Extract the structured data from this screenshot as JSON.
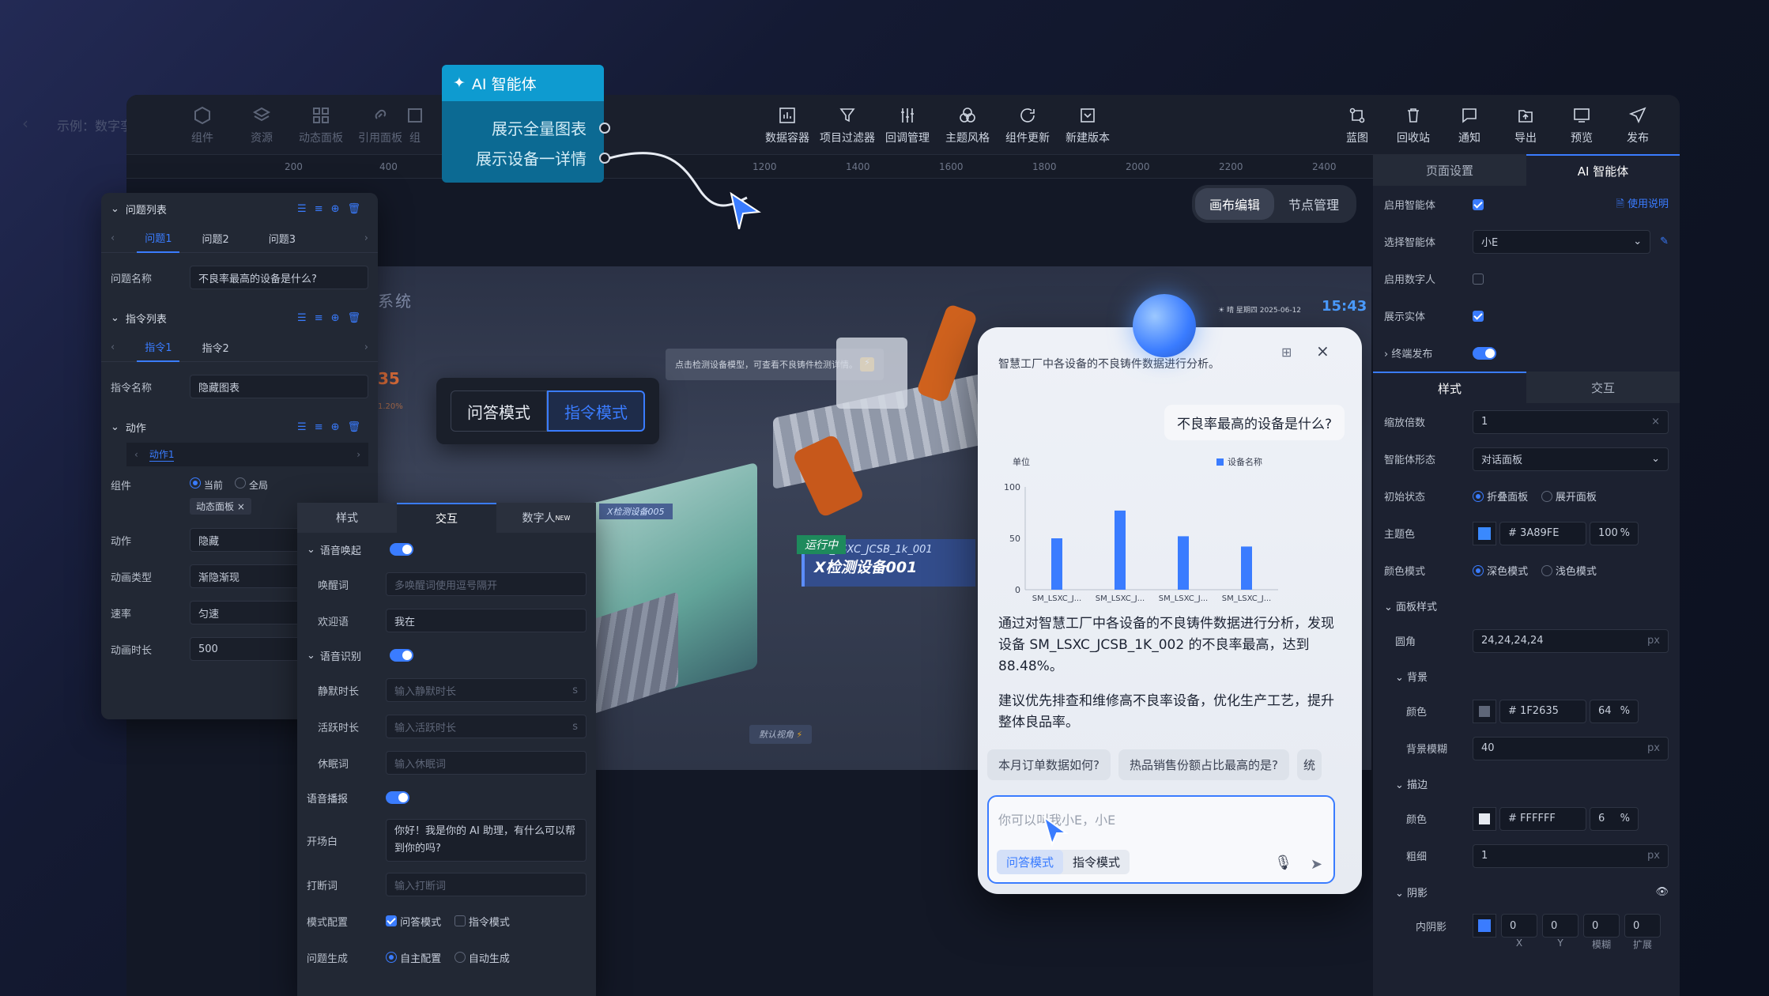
{
  "app": {
    "title": "示例：数字孪生...",
    "topleft_tools": [
      "组件",
      "资源",
      "动态面板",
      "引用面板",
      "组"
    ]
  },
  "toolbar": {
    "center": [
      "数据容器",
      "项目过滤器",
      "回调管理",
      "主题风格",
      "组件更新",
      "新建版本"
    ],
    "right": [
      "蓝图",
      "回收站",
      "通知",
      "导出",
      "预览",
      "发布"
    ]
  },
  "ai_popup": {
    "title": "AI 智能体",
    "items": [
      "展示全量图表",
      "展示设备一详情"
    ]
  },
  "ruler": {
    "ticks": [
      "200",
      "400",
      "1200",
      "1400",
      "1600",
      "1800",
      "2000",
      "2200",
      "2400"
    ]
  },
  "canvas_tabs": {
    "edit": "画布编辑",
    "node": "节点管理"
  },
  "left_panel": {
    "q_list_title": "问题列表",
    "q_tabs": [
      "问题1",
      "问题2",
      "问题3"
    ],
    "q_name_label": "问题名称",
    "q_name_value": "不良率最高的设备是什么?",
    "cmd_list_title": "指令列表",
    "cmd_tabs": [
      "指令1",
      "指令2"
    ],
    "cmd_name_label": "指令名称",
    "cmd_name_value": "隐藏图表",
    "action_title": "动作",
    "action_tab": "动作1",
    "component_label": "组件",
    "radio_current": "当前",
    "radio_all": "全局",
    "tag": "动态面板",
    "action_label": "动作",
    "action_value": "隐藏",
    "anim_type_label": "动画类型",
    "anim_type_value": "渐隐渐现",
    "speed_label": "速率",
    "speed_value": "匀速",
    "duration_label": "动画时长",
    "duration_value": "500"
  },
  "mode_switch": {
    "qa": "问答模式",
    "cmd": "指令模式"
  },
  "inter_panel": {
    "tabs": [
      "样式",
      "交互",
      "数字人"
    ],
    "new_badge": "NEW",
    "wake_title": "语音唤起",
    "wake_word_label": "唤醒词",
    "wake_word_ph": "多唤醒词使用逗号隔开",
    "welcome_label": "欢迎语",
    "welcome_value": "我在",
    "asr_title": "语音识别",
    "silence_label": "静默时长",
    "silence_ph": "输入静默时长",
    "active_label": "活跃时长",
    "active_ph": "输入活跃时长",
    "unit_s": "s",
    "sleep_label": "休眠词",
    "sleep_ph": "输入休眠词",
    "tts_label": "语音播报",
    "opening_label": "开场白",
    "opening_value": "你好！我是你的 AI 助理，有什么可以帮到你的吗?",
    "interrupt_label": "打断词",
    "interrupt_ph": "输入打断词",
    "mode_cfg_label": "模式配置",
    "mode_qa": "问答模式",
    "mode_cmd": "指令模式",
    "q_gen_label": "问题生成",
    "q_gen_self": "自主配置",
    "q_gen_auto": "自动生成"
  },
  "scene": {
    "title": "系统",
    "tip": "点击检测设备模型，可查看不良铸件检测详情。",
    "status": "运行中",
    "device_code": "SM_LSXC_JCSB_1k_001",
    "device_name": "X检测设备001",
    "small_label": "X检测设备005",
    "default_view": "默认视角",
    "weather": "晴",
    "weekday": "星期四",
    "date": "2025-06-12",
    "time": "15:43",
    "num": "35",
    "pct": "1.20%"
  },
  "chat": {
    "intro": "智慧工厂中各设备的不良铸件数据进行分析。",
    "question": "不良率最高的设备是什么?",
    "answer1": "通过对智慧工厂中各设备的不良铸件数据进行分析，发现设备 SM_LSXC_JCSB_1K_002 的不良率最高，达到 88.48%。",
    "answer2": "建议优先排查和维修高不良率设备，优化生产工艺，提升整体良品率。",
    "suggestions": [
      "本月订单数据如何?",
      "热品销售份额占比最高的是?",
      "统"
    ],
    "input_ph": "你可以叫我小E，小E",
    "mode_qa": "问答模式",
    "mode_cmd": "指令模式"
  },
  "chart_data": {
    "type": "bar",
    "categories": [
      "SM_LSXC_J...",
      "SM_LSXC_J...",
      "SM_LSXC_J...",
      "SM_LSXC_J..."
    ],
    "values": [
      50,
      77,
      52,
      42
    ],
    "ylabel": "单位",
    "ylim": [
      0,
      100
    ],
    "yticks": [
      "100",
      "50",
      "0"
    ],
    "series": [
      {
        "name": "设备名称",
        "values": [
          50,
          77,
          52,
          42
        ]
      }
    ],
    "legend": "top-right",
    "color": "#3a7cff"
  },
  "right_panel": {
    "tabs": [
      "页面设置",
      "AI 智能体"
    ],
    "enable_agent": "启用智能体",
    "help": "使用说明",
    "select_agent": "选择智能体",
    "agent_value": "小E",
    "enable_human": "启用数字人",
    "show_entity": "展示实体",
    "terminal": "终端发布",
    "sub_tabs": [
      "样式",
      "交互"
    ],
    "scale_label": "缩放倍数",
    "scale_value": "1",
    "shape_label": "智能体形态",
    "shape_value": "对话面板",
    "init_label": "初始状态",
    "init_fold": "折叠面板",
    "init_unfold": "展开面板",
    "theme_label": "主题色",
    "theme_hex": "3A89FE",
    "theme_pct": "100",
    "pct": "%",
    "color_mode_label": "颜色模式",
    "dark": "深色模式",
    "light": "浅色模式",
    "panel_style": "面板样式",
    "radius_label": "圆角",
    "radius_value": "24,24,24,24",
    "px": "px",
    "bg_title": "背景",
    "bg_color_label": "颜色",
    "bg_hex": "1F2635",
    "bg_pct": "64",
    "blur_label": "背景模糊",
    "blur_value": "40",
    "stroke_title": "描边",
    "stroke_color_label": "颜色",
    "stroke_hex": "FFFFFF",
    "stroke_pct": "6",
    "thick_label": "粗细",
    "thick_value": "1",
    "shadow_title": "阴影",
    "inner_label": "内阴影",
    "shadow_vals": [
      "0",
      "0",
      "0",
      "0"
    ],
    "shadow_axes": [
      "X",
      "Y",
      "模糊",
      "扩展"
    ],
    "hash": "#"
  },
  "colors": {
    "accent": "#3a7cff",
    "theme": "#3A89FE",
    "ai_header": "#0c6a93"
  }
}
